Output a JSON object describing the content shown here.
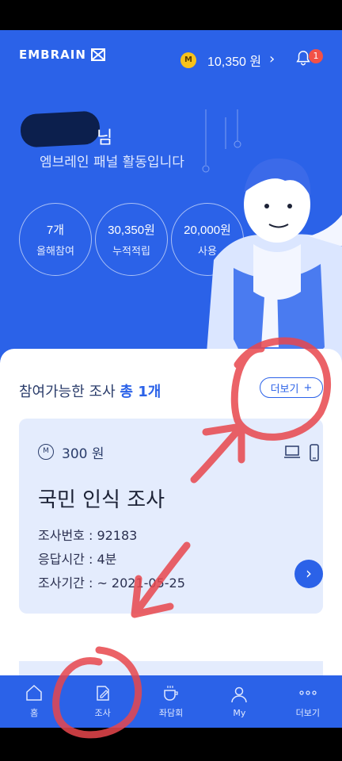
{
  "header": {
    "logo_text": "EMBRAIN",
    "coin_label": "M",
    "points": "10,350 원",
    "notification_count": "1"
  },
  "profile": {
    "name_suffix": "님",
    "greeting": "엠브레인 패널 활동입니다"
  },
  "stats": [
    {
      "value": "7개",
      "label": "올해참여"
    },
    {
      "value": "30,350원",
      "label": "누적적립"
    },
    {
      "value": "20,000원",
      "label": "사용"
    }
  ],
  "surveys": {
    "section_title": "참여가능한 조사",
    "section_count": "총 1개",
    "more_label": "더보기",
    "card": {
      "coin_label": "M",
      "reward": "300 원",
      "title": "국민 인식 조사",
      "number": "조사번호 : 92183",
      "duration": "응답시간 : 4분",
      "period": "조사기간 : ~ 2021-05-25"
    }
  },
  "nav": [
    {
      "label": "홈",
      "icon": "home-icon"
    },
    {
      "label": "조사",
      "icon": "survey-edit-icon"
    },
    {
      "label": "좌담회",
      "icon": "coffee-icon"
    },
    {
      "label": "My",
      "icon": "user-icon"
    },
    {
      "label": "더보기",
      "icon": "more-dots-icon"
    }
  ],
  "colors": {
    "brand": "#2b62e8",
    "card_bg": "#e4ecfd",
    "annotation": "#e8474c"
  }
}
